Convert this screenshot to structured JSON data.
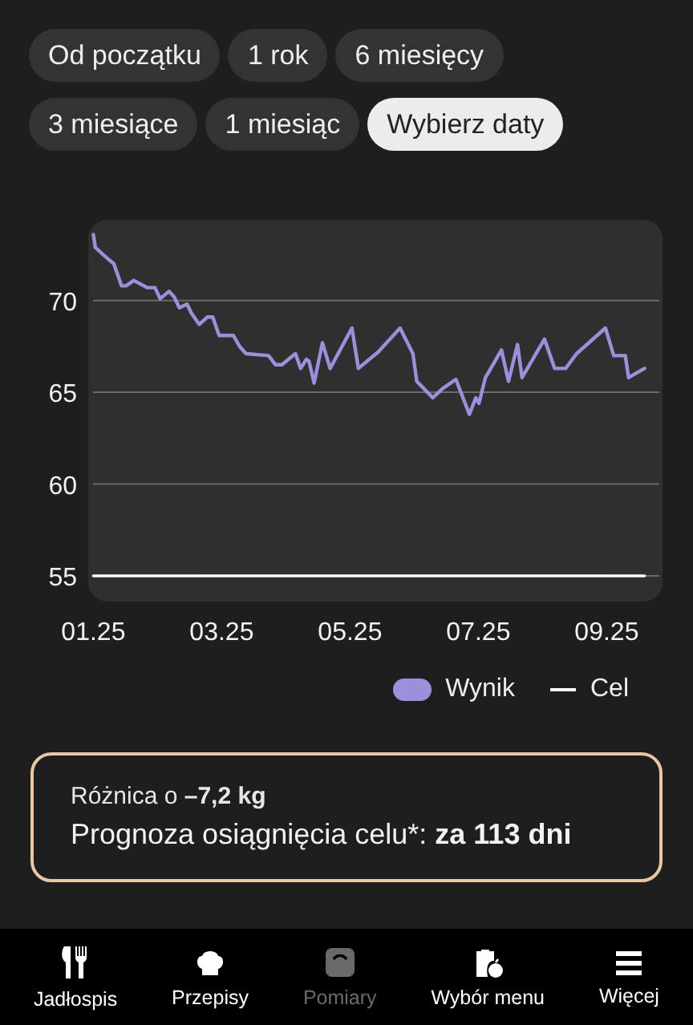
{
  "filters": [
    {
      "label": "Od początku",
      "selected": false
    },
    {
      "label": "1 rok",
      "selected": false
    },
    {
      "label": "6 miesięcy",
      "selected": false
    },
    {
      "label": "3 miesiące",
      "selected": false
    },
    {
      "label": "1 miesiąc",
      "selected": false
    },
    {
      "label": "Wybierz daty",
      "selected": true
    }
  ],
  "chart": {
    "chart_data": {
      "type": "line",
      "x": [
        1.25,
        1.28,
        1.4,
        1.57,
        1.69,
        1.76,
        1.88,
        1.98,
        2.09,
        2.21,
        2.29,
        2.43,
        2.51,
        2.59,
        2.71,
        2.78,
        2.9,
        3.03,
        3.11,
        3.21,
        3.43,
        3.53,
        3.63,
        3.98,
        4.09,
        4.19,
        4.29,
        4.4,
        4.48,
        4.57,
        4.61,
        4.69,
        4.82,
        4.94,
        5.28,
        5.38,
        5.69,
        6.03,
        6.23,
        6.29,
        6.54,
        6.69,
        6.9,
        7.11,
        7.21,
        7.26,
        7.36,
        7.61,
        7.72,
        7.86,
        7.93,
        8.28,
        8.44,
        8.61,
        8.78,
        9.23,
        9.36,
        9.54,
        9.59,
        9.69,
        9.84
      ],
      "series": [
        {
          "name": "Wynik",
          "color": "#9d8fdc",
          "values": [
            73.6,
            72.9,
            72.5,
            72.0,
            70.8,
            70.8,
            71.1,
            70.9,
            70.7,
            70.7,
            70.1,
            70.5,
            70.2,
            69.6,
            69.8,
            69.3,
            68.7,
            69.1,
            69.1,
            68.1,
            68.1,
            67.5,
            67.1,
            67.0,
            66.5,
            66.5,
            66.8,
            67.1,
            66.3,
            66.8,
            66.7,
            65.5,
            67.7,
            66.3,
            68.5,
            66.3,
            67.2,
            68.5,
            67.1,
            65.6,
            64.7,
            65.2,
            65.7,
            63.8,
            64.7,
            64.4,
            65.8,
            67.3,
            65.6,
            67.6,
            65.8,
            67.9,
            66.3,
            66.3,
            67.1,
            68.5,
            67.0,
            67.0,
            65.8,
            66.0,
            66.3
          ]
        },
        {
          "name": "Cel",
          "color": "#ffffff",
          "values": [
            55,
            55,
            55,
            55,
            55,
            55,
            55,
            55,
            55,
            55,
            55,
            55,
            55,
            55,
            55,
            55,
            55,
            55,
            55,
            55,
            55,
            55,
            55,
            55,
            55,
            55,
            55,
            55,
            55,
            55,
            55,
            55,
            55,
            55,
            55,
            55,
            55,
            55,
            55,
            55,
            55,
            55,
            55,
            55,
            55,
            55,
            55,
            55,
            55,
            55,
            55,
            55,
            55,
            55,
            55,
            55,
            55,
            55,
            55,
            55,
            55
          ]
        }
      ],
      "grid": true,
      "xlim": [
        1.17,
        10.12
      ],
      "ylim": [
        53.6,
        74.4
      ],
      "xticks": [
        {
          "value": 1.25,
          "label": "01.25"
        },
        {
          "value": 3.25,
          "label": "03.25"
        },
        {
          "value": 5.25,
          "label": "05.25"
        },
        {
          "value": 7.25,
          "label": "07.25"
        },
        {
          "value": 9.25,
          "label": "09.25"
        }
      ],
      "yticks": [
        55,
        60,
        65,
        70
      ]
    }
  },
  "summary": {
    "difference": "Różnica o **–7,2 kg**",
    "forecast": "Prognoza osiągnięcia celu*: **za 113 dni**"
  },
  "nav": [
    {
      "label": "Jadłospis",
      "selected": false
    },
    {
      "label": "Przepisy",
      "selected": false
    },
    {
      "label": "Pomiary",
      "selected": true
    },
    {
      "label": "Wybór menu",
      "selected": false
    },
    {
      "label": "Więcej",
      "selected": false
    }
  ]
}
